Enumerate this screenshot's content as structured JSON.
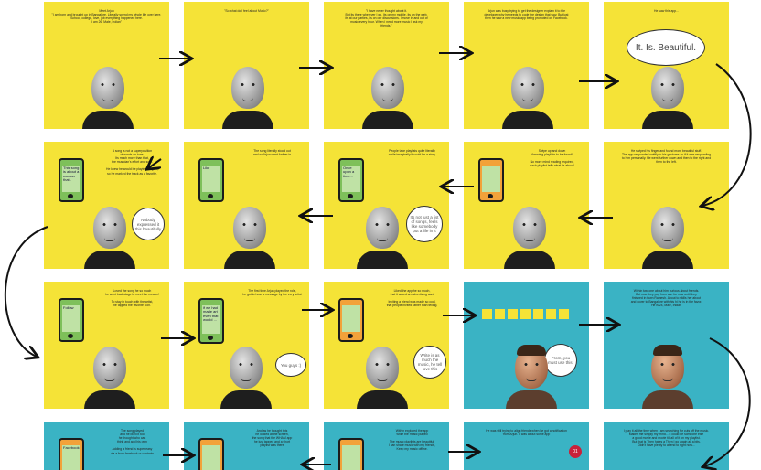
{
  "panels": {
    "r1p1": {
      "caption": "Meet Arjun\n\"I am born and brought up in Bangalore. Literally spend my whole life over here.\nSchool, college, love, job everything happened here.\nI am 26, Male, Indian\""
    },
    "r1p2": {
      "caption": "\"So what do I feel about Music?\""
    },
    "r1p3": {
      "caption": "\"I have never thought about it.\nBut its there wherever I go. Its on my mobile, its on the web,\nits at our parties, its on our discussions. I move in and out of\nmusic every hour. When I need more music I ask my\nfriends.\""
    },
    "r1p4": {
      "caption": "Arjun was busy trying to get the designer explain it to the\ndeveloper why he needs to code the design that way. But just\nthen he saw a new music app being promoted on Facebook."
    },
    "r1p5": {
      "caption": "He saw this app...",
      "bubble": "It. Is. Beautiful."
    },
    "r2p1": {
      "caption": "A song is not a superposition\nof words on tune.\nIts much more than that,\nthe musician's effort and soul.\n\nHe knew he would be playing it again,\nso he marked the track as a favorite.",
      "screen": "This song is about a woman that..",
      "bubble": "Nobody expressed it this beautifully"
    },
    "r2p2": {
      "caption": "The song literally stood out\nand so Arjun went further in",
      "screen": "Like"
    },
    "r2p3": {
      "caption": "People take playlists quite literally\nwhile imaginally it could be a story",
      "screen": "Once upon a time...",
      "bubble": "Its not just a list of songs, feels like somebody put a life in it"
    },
    "r2p4": {
      "caption": "Swipe up and down\nAmazing playlists to be found!\n\nNo more mind reading required,\neach playlist tells what its about!"
    },
    "r2p5": {
      "caption": "He swiped his finger and found more beautiful stuff.\nThe app responded swiftly to his gestures as if it was responding\nto him personally. He went further down and then to the right and\nthen to the left."
    },
    "r3p1": {
      "caption": "Loved the song he so much\nhe went backstage to meet the creator!\n\nTo stay in touch with the artist,\nhe tapped the favorite icon.",
      "screen": "Follow"
    },
    "r3p2": {
      "caption": "The first time Arjun played the role,\nhe got to hear a message by the very artist",
      "screen": "if we had made art even that would ...",
      "bubble": "You guys :)"
    },
    "r3p3": {
      "caption": "Liked the app he so much,\nthat it saved an advertising card\n\nInviting a friend was made so cool,\nthat people invited rather than telling.",
      "bubble": "Write is as much the music, he tell love this"
    },
    "r3p4": {
      "caption": "",
      "bubble": "From, you must use this!"
    },
    "r3p5": {
      "caption": "Within two one about him curious about friends.\nBut now they pay from can for now until they\nfinished in town Ramesh. About to skills her about\nand cover to Bangalore with his hi he is in the favor.\nHe is 24, Male, Indian"
    },
    "r4p1": {
      "caption": "The song played\nand he liked it too\nhe thought who can\nthink and add his own\n\nAdding a friend is super easy\nvia a from facebook or contacts",
      "screen": "Facebook"
    },
    "r4p2": {
      "caption": "And as he thought this\nhe looked at the screen,\nthe song that the WHAM app\nhe just tapped and a short\nplaylist was there"
    },
    "r4p3": {
      "caption": "Within explored the app\nwhile the music played\n\nThe music playlists are beautiful.\nI can share music with my friends,\nKeep my music offline."
    },
    "r4p4": {
      "caption": "He was still trying to align friends when he got a notification\nfrom Arjun. It was about some app",
      "badge": "01"
    },
    "r4p5": {
      "caption": "I play it all the time when I am searching for cuts off the music.\nMakes me simply my mind... It could be someone else\na good movie and movie till all of it on my playlist.\nBut that is Then hates a Then I go again all a bits.\nDidn't have plenty to attend to right now..."
    }
  },
  "colors": {
    "yellow": "#f5e337",
    "teal": "#3ab3c4",
    "arrow": "#111111"
  }
}
